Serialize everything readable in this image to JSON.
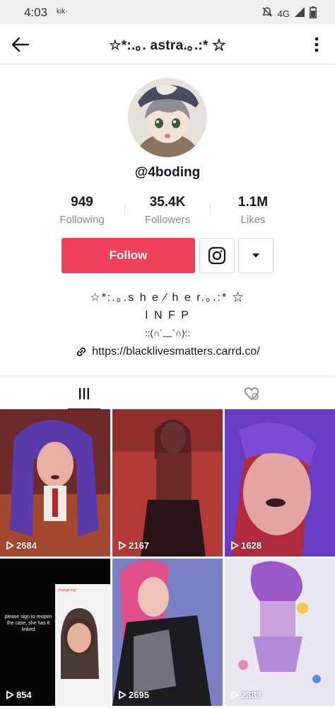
{
  "status_bar": {
    "time": "4:03",
    "carrier": "kik·",
    "network": "4G"
  },
  "header": {
    "title": "☆*:.｡. astra.｡.:* ☆"
  },
  "profile": {
    "username": "@4boding",
    "stats": [
      {
        "value": "949",
        "label": "Following"
      },
      {
        "value": "35.4K",
        "label": "Followers"
      },
      {
        "value": "1.1M",
        "label": "Likes"
      }
    ],
    "follow_label": "Follow",
    "bio": [
      "☆*:.｡.s h e ⁄ h e r.｡.:* ☆",
      "I N F P",
      "::(∩´﹏`∩)::"
    ],
    "link": "https://blacklivesmatters.carrd.co/"
  },
  "tabs": [
    {
      "icon": "grid-icon"
    },
    {
      "icon": "liked-heart-icon"
    }
  ],
  "videos": [
    {
      "views": "2684"
    },
    {
      "views": "2167"
    },
    {
      "views": "1628"
    },
    {
      "views": "854",
      "caption": "please sign to reopen the case, she has it linked",
      "tag": "change.org"
    },
    {
      "views": "2695"
    },
    {
      "views": "2383"
    }
  ],
  "colors": {
    "follow": "#ee3f5b",
    "text": "#161823",
    "muted": "#8a8b91"
  }
}
